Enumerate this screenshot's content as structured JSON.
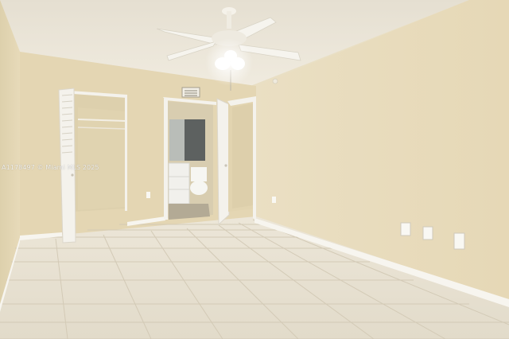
{
  "scene": {
    "description_free": true,
    "watermark_text": "A1178497 © Miami MLS 2025",
    "colors": {
      "ceiling": "#ece6d8",
      "wall_right": "#e9dcbd",
      "wall_left": "#e6d9b8",
      "wall_back": "#e4d5b1",
      "floor": "#e6e0d2",
      "grout": "#cfc6b2",
      "baseboard": "#f7f5ef",
      "door": "#f4f2ec",
      "bath_tile": "#5d6160",
      "vanity": "#f1f0ec"
    },
    "icons": [
      "ceiling-fan-icon",
      "light-icon",
      "air-vent-icon",
      "power-outlet-icon",
      "light-switch-icon"
    ]
  }
}
